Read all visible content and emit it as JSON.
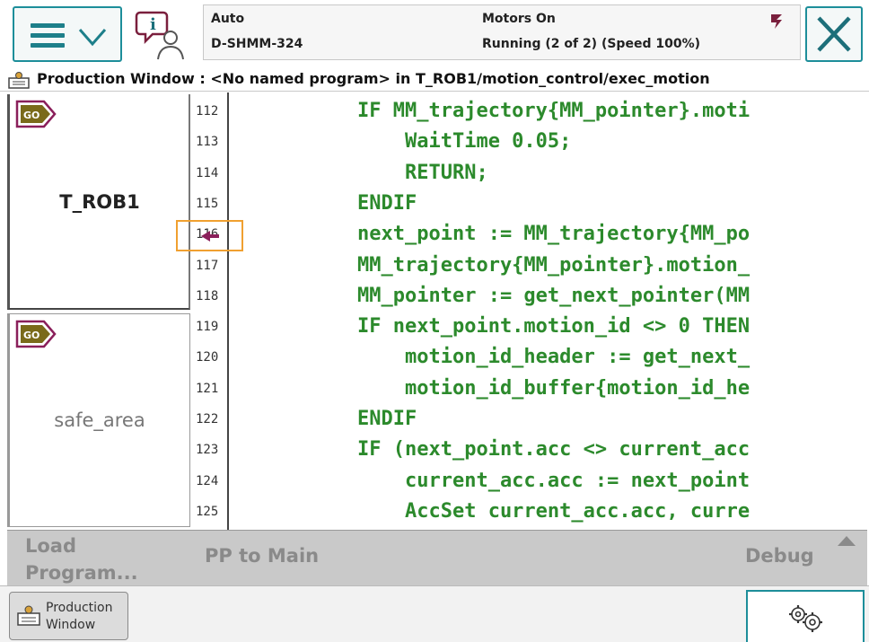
{
  "status": {
    "mode": "Auto",
    "controller": "D-SHMM-324",
    "motors": "Motors On",
    "run_state": "Running (2 of 2) (Speed 100%)"
  },
  "icons": {
    "menu": "hamburger-chevron-icon",
    "info": "event-log-icon",
    "run": "speed-icon",
    "close": "close-icon",
    "window": "production-window-icon",
    "go": "go-badge-icon",
    "settings": "gears-icon"
  },
  "colors": {
    "accent": "#1d8e9a",
    "code": "#2c8a2c",
    "pc_marker": "#f0a030",
    "go_badge": "#7a5c1a"
  },
  "window": {
    "title": "Production Window : <No named program> in T_ROB1/motion_control/exec_motion"
  },
  "tasks": [
    {
      "badge": "GO",
      "name": "T_ROB1"
    },
    {
      "badge": "GO",
      "name": "safe_area"
    }
  ],
  "code": {
    "lines": [
      {
        "num": "112",
        "text": "IF MM_trajectory{MM_pointer}.moti"
      },
      {
        "num": "113",
        "text": "    WaitTime 0.05;"
      },
      {
        "num": "114",
        "text": "    RETURN;"
      },
      {
        "num": "115",
        "text": "ENDIF"
      },
      {
        "num": "116",
        "text": "next_point := MM_trajectory{MM_po"
      },
      {
        "num": "117",
        "text": "MM_trajectory{MM_pointer}.motion_"
      },
      {
        "num": "118",
        "text": "MM_pointer := get_next_pointer(MM"
      },
      {
        "num": "119",
        "text": "IF next_point.motion_id <> 0 THEN"
      },
      {
        "num": "120",
        "text": "    motion_id_header := get_next_"
      },
      {
        "num": "121",
        "text": "    motion_id_buffer{motion_id_he"
      },
      {
        "num": "122",
        "text": "ENDIF"
      },
      {
        "num": "123",
        "text": "IF (next_point.acc <> current_acc"
      },
      {
        "num": "124",
        "text": "    current_acc.acc := next_point"
      },
      {
        "num": "125",
        "text": "    AccSet current_acc.acc, curre"
      }
    ]
  },
  "commands": {
    "load_line1": "Load",
    "load_line2": "Program...",
    "pp_main": "PP to Main",
    "debug": "Debug"
  },
  "taskbar": {
    "prod_line1": "Production",
    "prod_line2": "Window"
  }
}
